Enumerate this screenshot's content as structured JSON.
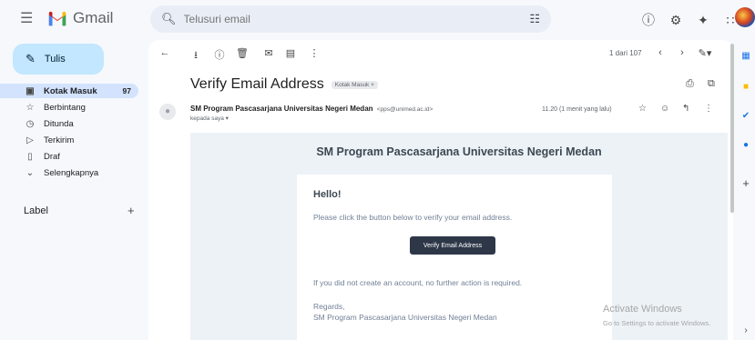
{
  "app": {
    "name": "Gmail",
    "colors": {
      "brand_blue": "#4285f4",
      "brand_red": "#ea4335",
      "brand_yellow": "#fbbc04",
      "brand_green": "#34a853",
      "compose_bg": "#c2e7ff",
      "active_nav": "#d3e3fd"
    }
  },
  "search": {
    "placeholder": "Telusuri email",
    "value": ""
  },
  "sidebar": {
    "compose_label": "Tulis",
    "items": [
      {
        "label": "Kotak Masuk",
        "count": "97",
        "icon": "inbox-icon",
        "active": true
      },
      {
        "label": "Berbintang",
        "icon": "star-icon"
      },
      {
        "label": "Ditunda",
        "icon": "clock-icon"
      },
      {
        "label": "Terkirim",
        "icon": "send-icon"
      },
      {
        "label": "Draf",
        "icon": "draft-icon"
      },
      {
        "label": "Selengkapnya",
        "icon": "chevron-down-icon"
      }
    ],
    "label_header": "Label"
  },
  "toolbar": {
    "pager": "1 dari 107"
  },
  "message": {
    "subject": "Verify Email Address",
    "chip": "Kotak Masuk ×",
    "sender_name": "SM Program Pascasarjana Universitas Negeri Medan",
    "sender_addr": "<pps@unimed.ac.id>",
    "to_me": "kepada saya ▾",
    "time": "11.20 (1 menit yang lalu)"
  },
  "email": {
    "header": "SM Program Pascasarjana Universitas Negeri Medan",
    "hello": "Hello!",
    "line1": "Please click the button below to verify your email address.",
    "button": "Verify Email Address",
    "line2": "If you did not create an account, no further action is required.",
    "regards": "Regards,",
    "signature": "SM Program Pascasarjana Universitas Negeri Medan"
  },
  "watermark": {
    "title": "Activate Windows",
    "subtitle": "Go to Settings to activate Windows."
  }
}
